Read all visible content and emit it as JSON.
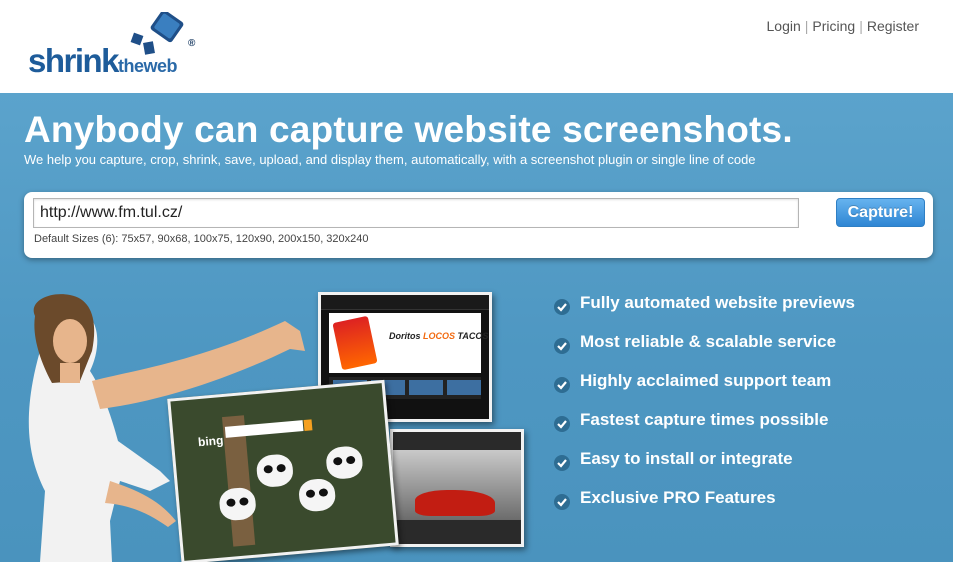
{
  "header": {
    "logo": {
      "part1": "shrink",
      "part2": "the",
      "part3": "web",
      "mark": "®"
    },
    "nav": [
      {
        "label": "Login"
      },
      {
        "label": "Pricing"
      },
      {
        "label": "Register"
      }
    ]
  },
  "hero": {
    "headline": "Anybody can capture website screenshots.",
    "subline": "We help you capture, crop, shrink, save, upload, and display them, automatically, with a screenshot plugin or single line of code"
  },
  "capture": {
    "url_value": "http://www.fm.tul.cz/",
    "sizes_text": "Default Sizes (6): 75x57, 90x68, 100x75, 120x90, 200x150, 320x240",
    "button_label": "Capture!"
  },
  "features": [
    {
      "label": "Fully automated website previews"
    },
    {
      "label": "Most reliable & scalable service"
    },
    {
      "label": "Highly acclaimed support team"
    },
    {
      "label": "Fastest capture times possible"
    },
    {
      "label": "Easy to install or integrate"
    },
    {
      "label": "Exclusive PRO Features"
    }
  ],
  "preview": {
    "taco_text_1": "Doritos",
    "taco_text_2": "LOCOS",
    "taco_text_3": "TACOS",
    "bing_label": "bing"
  },
  "colors": {
    "hero_bg": "#5ba3cc",
    "brand_blue": "#1e5c9a",
    "button_blue": "#2f86d4",
    "check_bg": "#2e6d93"
  }
}
